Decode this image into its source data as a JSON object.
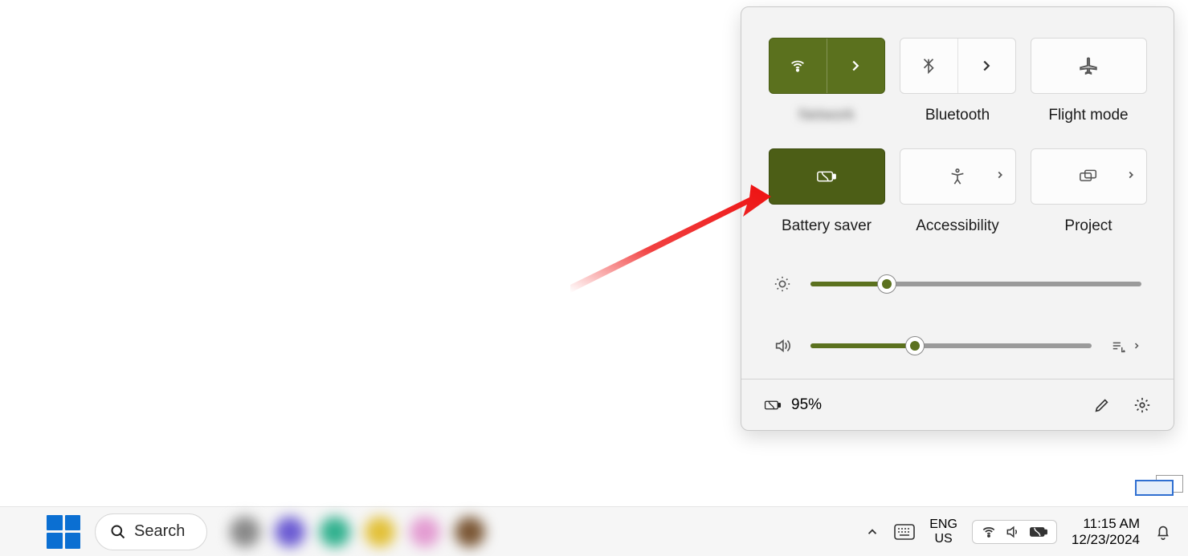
{
  "quick_settings": {
    "tiles": {
      "wifi": {
        "label": "Network",
        "active": true,
        "has_arrow": true
      },
      "bluetooth": {
        "label": "Bluetooth",
        "active": false,
        "has_arrow": true
      },
      "flight": {
        "label": "Flight mode",
        "active": false,
        "has_arrow": false
      },
      "battery": {
        "label": "Battery saver",
        "active": true,
        "has_arrow": false
      },
      "accessibility": {
        "label": "Accessibility",
        "active": false,
        "has_arrow": true
      },
      "project": {
        "label": "Project",
        "active": false,
        "has_arrow": true
      }
    },
    "sliders": {
      "brightness_pct": 23,
      "volume_pct": 37
    },
    "footer": {
      "battery_text": "95%"
    }
  },
  "taskbar": {
    "search_label": "Search",
    "lang_top": "ENG",
    "lang_bottom": "US",
    "time": "11:15 AM",
    "date": "12/23/2024"
  },
  "annotation": {
    "description": "Red arrow pointing to Battery saver tile"
  }
}
